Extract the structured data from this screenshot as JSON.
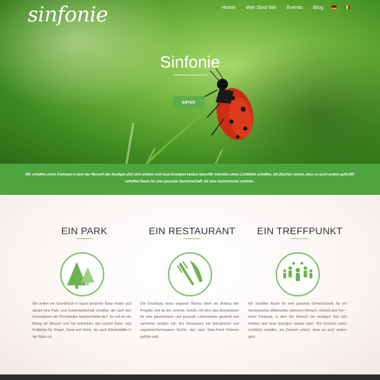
{
  "logo": "sinfonie",
  "nav": [
    "Home",
    "Wer Sind Wir",
    "Events",
    "Blog"
  ],
  "hero": {
    "title": "Sinfonie",
    "button": "ENTER"
  },
  "band": {
    "text": "Wir schaffen einen Freiraum in dem der Mensch der heutigen Zeit sich erleben und neue Energien tanken kann.Wir möchten einen Lichtblick schaffen, ein Zeichen setzen, dass es auch anders geht.Wir schaffen Raum für eine gesunde Gemeinschaft, für eine harmonische sinfonie ."
  },
  "columns": [
    {
      "title": "EIN PARK",
      "icon": "trees-icon",
      "text": "Wir wollen ein Grundstück in kaum berührter Natur finden und darauf eine Park- und Gartenlandschaft schaffen, die nach den Grundsätzen der Permakultur bewirtschaftet wird. So soll ein ein Biotop für Mensch und Tier entstehen, das sowohl Ruhe- und Kraftplatz für Körper, Geist und Seele, als auch Arbeitsstätte in der Natur ist."
    },
    {
      "title": "EIN RESTAURANT",
      "icon": "cutlery-icon",
      "text": "Die Gründung eines veganen Bistros steht am Anfang des Projekts und ist der zentrale Schritt, mit dem das Bewusstsein für eine ganzheitliche und gesunde Lebensweise geweckt und verbreitet werden soll. Ein Restaurant mit biologischer und vegetarischer/veganer Küche, das nach Slow-Food Kriterien geführt wird."
    },
    {
      "title": "EIN TREFFPUNKT",
      "icon": "people-icon",
      "text": "Wir schaffen Raum für eine gesunde Gemeinschaft, für ein harmonisches Miteinander zwischen Mensch, Umwelt und Tier – einen Freiraum, in dem der Mensch der heutigen Zeit sich erleben und neue Energien tanken kann. Wir möchten einen Lichtblick schaffen, ein Zeichen setzen, dass es auch anders geht."
    }
  ],
  "colors": {
    "accent": "#4ea53f",
    "icon_green": "#7fc06a",
    "footer": "#2d2d2d"
  }
}
